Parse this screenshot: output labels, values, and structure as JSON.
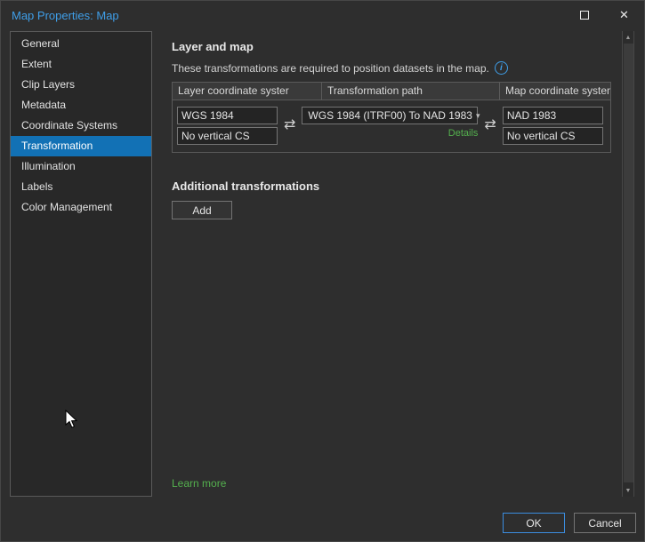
{
  "window": {
    "title": "Map Properties: Map",
    "maximize_label": "maximize",
    "close_glyph": "✕"
  },
  "colors": {
    "accent_blue": "#3f9ee8",
    "selection_blue": "#1271b5",
    "link_green": "#54b04e"
  },
  "sidebar": {
    "items": [
      {
        "label": "General",
        "selected": false
      },
      {
        "label": "Extent",
        "selected": false
      },
      {
        "label": "Clip Layers",
        "selected": false
      },
      {
        "label": "Metadata",
        "selected": false
      },
      {
        "label": "Coordinate Systems",
        "selected": false
      },
      {
        "label": "Transformation",
        "selected": true
      },
      {
        "label": "Illumination",
        "selected": false
      },
      {
        "label": "Labels",
        "selected": false
      },
      {
        "label": "Color Management",
        "selected": false
      }
    ]
  },
  "main": {
    "layer_and_map_title": "Layer and map",
    "description": "These transformations are required to position datasets in the map.",
    "info_icon_glyph": "i",
    "table": {
      "headers": [
        "Layer coordinate syster",
        "Transformation path",
        "Map coordinate system"
      ],
      "row": {
        "layer_cs": "WGS 1984",
        "layer_vcs": "No vertical CS",
        "transformation": "WGS 1984 (ITRF00) To NAD 1983",
        "details_label": "Details",
        "map_cs": "NAD 1983",
        "map_vcs": "No vertical CS"
      },
      "swap_icon_glyph": "⇄",
      "dropdown_chevron": "▾"
    },
    "additional_title": "Additional transformations",
    "add_button_label": "Add",
    "learn_more_label": "Learn more"
  },
  "scrollbar": {
    "up_glyph": "▲",
    "down_glyph": "▼"
  },
  "footer": {
    "ok_label": "OK",
    "cancel_label": "Cancel"
  }
}
